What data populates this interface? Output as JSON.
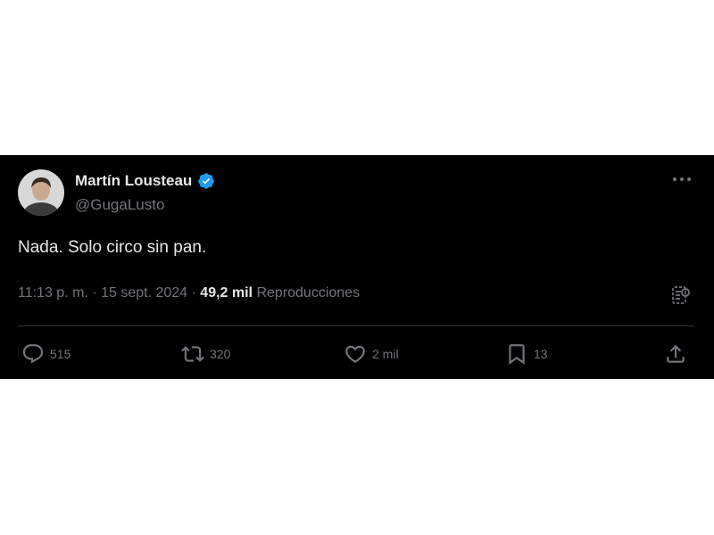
{
  "tweet": {
    "author_name": "Martín Lousteau",
    "author_handle": "@GugaLusto",
    "verified": true,
    "text": "Nada. Solo circo sin pan.",
    "time": "11:13 p. m.",
    "separator": "·",
    "date": "15 sept. 2024",
    "views_count": "49,2 mil",
    "views_label": "Reproducciones",
    "actions": {
      "replies": "515",
      "retweets": "320",
      "likes": "2 mil",
      "bookmarks": "13"
    }
  },
  "icons": {
    "verified": "verified-badge-icon",
    "more": "more-options-icon",
    "grok": "grok-icon",
    "reply": "reply-icon",
    "retweet": "retweet-icon",
    "like": "heart-icon",
    "bookmark": "bookmark-icon",
    "share": "share-icon"
  },
  "colors": {
    "card_background": "#000000",
    "page_background": "#ffffff",
    "primary_text": "#e7e9ea",
    "secondary_text": "#71767b",
    "verified_blue": "#1d9bf0",
    "divider": "#2f3336"
  }
}
